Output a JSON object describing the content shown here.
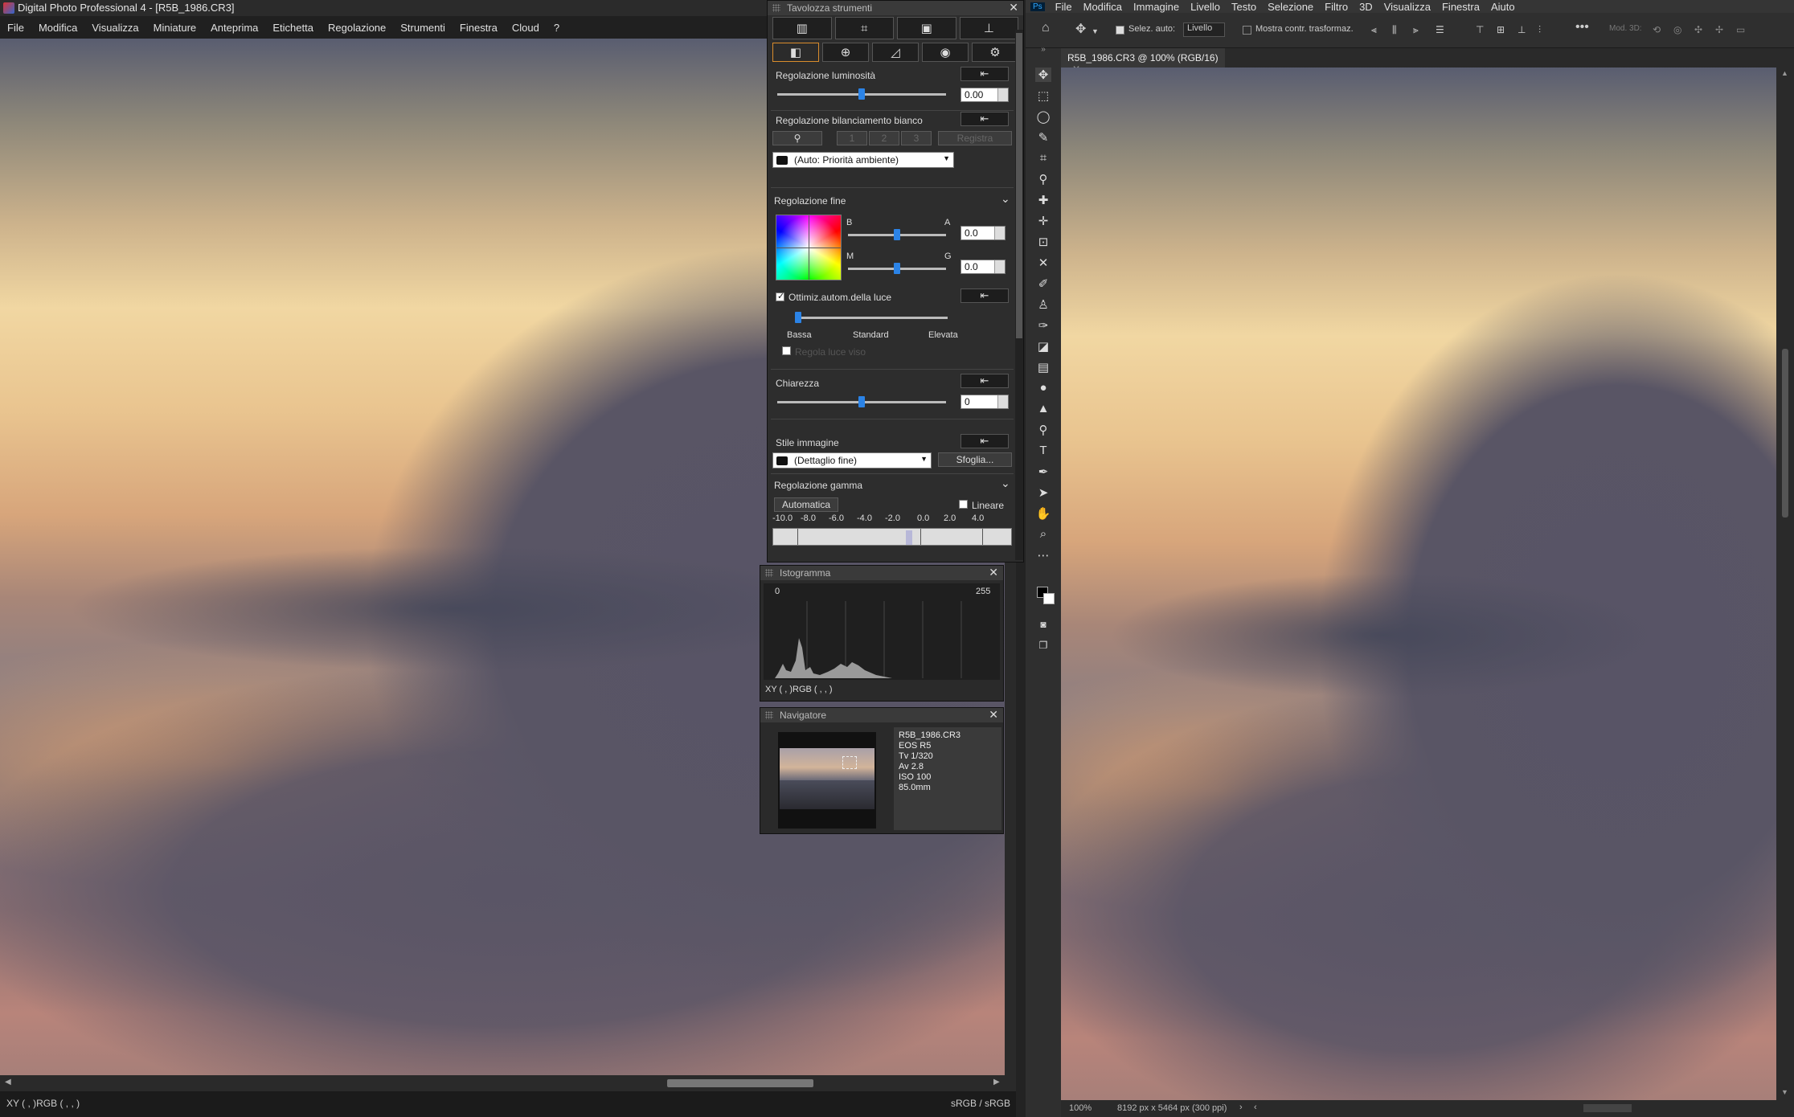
{
  "dpp": {
    "title": "Digital Photo Professional 4 - [R5B_1986.CR3]",
    "menu": [
      "File",
      "Modifica",
      "Visualizza",
      "Miniature",
      "Anteprima",
      "Etichetta",
      "Regolazione",
      "Strumenti",
      "Finestra",
      "Cloud",
      "?"
    ],
    "status_left": "XY (    ,    )RGB (    ,    ,    )",
    "status_right": "sRGB / sRGB"
  },
  "palette": {
    "title": "Tavolozza strumenti",
    "brightness_label": "Regolazione luminosità",
    "brightness_value": "0.00",
    "brightness_level": 0.5,
    "wb_label": "Regolazione bilanciamento bianco",
    "wb_buttons": [
      "1",
      "2",
      "3"
    ],
    "wb_register": "Registra",
    "wb_mode": "(Auto: Priorità ambiente)",
    "fine_label": "Regolazione fine",
    "fine_b": "B",
    "fine_a": "A",
    "fine_m": "M",
    "fine_g": "G",
    "fine_ba_value": "0.0",
    "fine_mg_value": "0.0",
    "alo_label": "Ottimiz.autom.della luce",
    "alo_levels": [
      "Bassa",
      "Standard",
      "Elevata"
    ],
    "face_label": "Regola luce viso",
    "clarity_label": "Chiarezza",
    "clarity_value": "0",
    "clarity_level": 0.5,
    "style_label": "Stile immagine",
    "style_value": "(Dettaglio fine)",
    "style_browse": "Sfoglia...",
    "gamma_label": "Regolazione gamma",
    "gamma_auto": "Automatica",
    "gamma_linear": "Lineare",
    "gamma_ticks": [
      "-10.0",
      "-8.0",
      "-6.0",
      "-4.0",
      "-2.0",
      "0.0",
      "2.0",
      "4.0"
    ]
  },
  "histogram": {
    "title": "Istogramma",
    "min": "0",
    "max": "255",
    "readout": "XY (    ,    )RGB (    ,    ,    )"
  },
  "navigator": {
    "title": "Navigatore",
    "info": [
      "R5B_1986.CR3",
      "EOS R5",
      "Tv 1/320",
      "Av 2.8",
      "ISO 100",
      "85.0mm"
    ]
  },
  "ps": {
    "logo": "Ps",
    "menu": [
      "File",
      "Modifica",
      "Immagine",
      "Livello",
      "Testo",
      "Selezione",
      "Filtro",
      "3D",
      "Visualizza",
      "Finestra",
      "Aiuto"
    ],
    "auto_select": "Selez. auto:",
    "layer_select": "Livello",
    "show_transform": "Mostra contr. trasformaz.",
    "mode3d": "Mod. 3D:",
    "tab": "R5B_1986.CR3 @ 100% (RGB/16)",
    "zoom": "100%",
    "docinfo": "8192 px x 5464 px (300 ppi)"
  }
}
